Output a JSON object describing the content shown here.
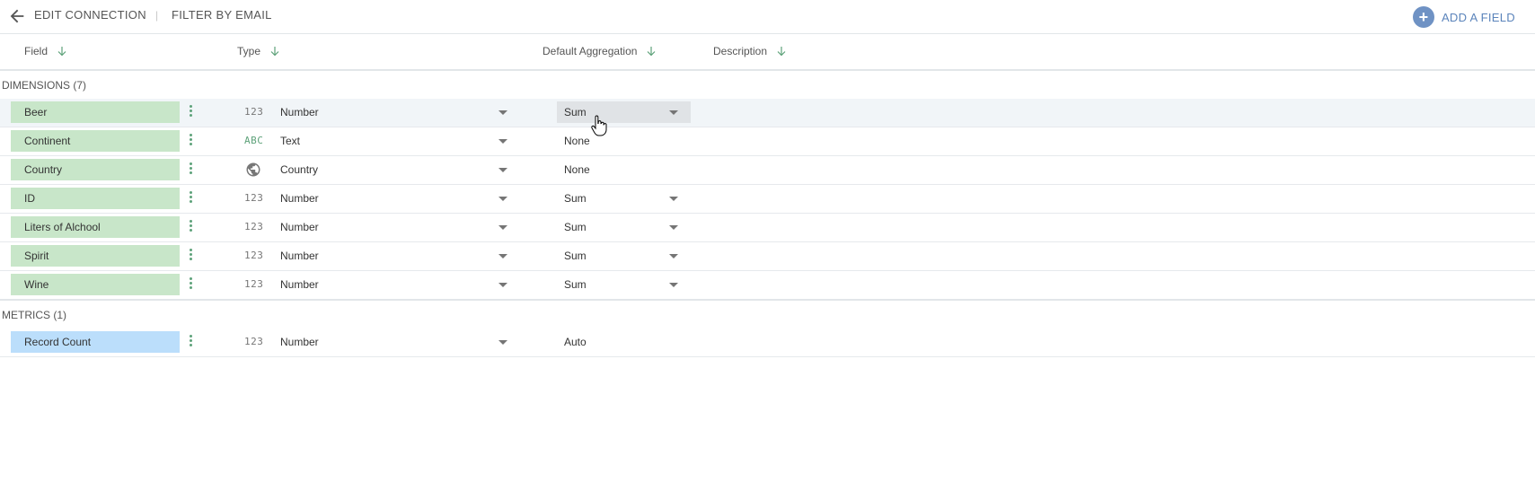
{
  "header": {
    "edit_connection": "EDIT CONNECTION",
    "separator": "|",
    "filter_by_email": "FILTER BY EMAIL",
    "add_field_icon": "+",
    "add_field_label": "ADD A FIELD"
  },
  "columns": {
    "field": "Field",
    "type": "Type",
    "default_aggregation": "Default Aggregation",
    "description": "Description"
  },
  "sections": {
    "dimensions": "DIMENSIONS (7)",
    "metrics": "METRICS (1)"
  },
  "dimensions": [
    {
      "field": "Beer",
      "type_icon": "123",
      "type": "Number",
      "aggregation": "Sum"
    },
    {
      "field": "Continent",
      "type_icon": "ABC",
      "type": "Text",
      "aggregation": "None"
    },
    {
      "field": "Country",
      "type_icon": "globe-icon",
      "type": "Country",
      "aggregation": "None"
    },
    {
      "field": "ID",
      "type_icon": "123",
      "type": "Number",
      "aggregation": "Sum"
    },
    {
      "field": "Liters of Alchool",
      "type_icon": "123",
      "type": "Number",
      "aggregation": "Sum"
    },
    {
      "field": "Spirit",
      "type_icon": "123",
      "type": "Number",
      "aggregation": "Sum"
    },
    {
      "field": "Wine",
      "type_icon": "123",
      "type": "Number",
      "aggregation": "Sum"
    }
  ],
  "metrics": [
    {
      "field": "Record Count",
      "type_icon": "123",
      "type": "Number",
      "aggregation": "Auto"
    }
  ],
  "colors": {
    "dimension_chip": "#c8e6c9",
    "metric_chip": "#bbdefb",
    "accent": "#5b84bb",
    "kebab": "#5ea27a"
  }
}
